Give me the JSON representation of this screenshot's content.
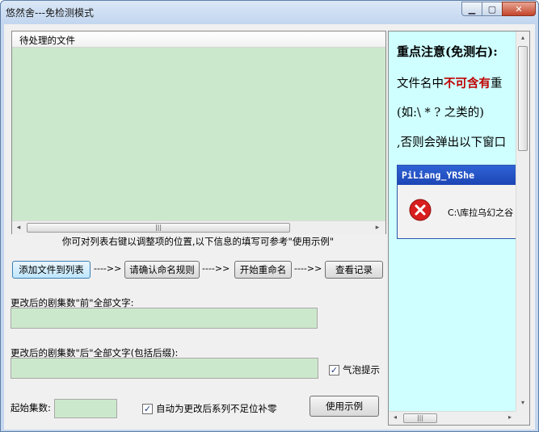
{
  "window": {
    "title": "悠然舍---免检测模式",
    "minimize_glyph": "▁",
    "maximize_glyph": "▢",
    "close_glyph": "✕"
  },
  "file_list": {
    "header": "待处理的文件",
    "scroll_left": "◂",
    "scroll_right": "▸",
    "scroll_thumb_grip": "|||"
  },
  "hint": "你可对列表右键以调整项的位置,以下信息的填写可参考\"使用示例\"",
  "steps": {
    "add_files": "添加文件到列表",
    "confirm_rule": "请确认命名规则",
    "start_rename": "开始重命名",
    "view_log": "查看记录",
    "arrow": "---->>"
  },
  "fields": {
    "before_label": "更改后的剧集数\"前\"全部文字:",
    "before_value": "",
    "after_label": "更改后的剧集数\"后\"全部文字(包括后缀):",
    "after_value": "",
    "start_label": "起始集数:",
    "start_value": ""
  },
  "options": {
    "bubble_tip": "气泡提示",
    "bubble_tip_checked": true,
    "auto_pad": "自动为更改后系列不足位补零",
    "auto_pad_checked": true,
    "check_glyph": "✓"
  },
  "example_button": "使用示例",
  "info_panel": {
    "title": "重点注意(免测右):",
    "line1_prefix": "文件名中",
    "line1_emphasis": "不可含有",
    "line1_suffix": "重",
    "line2": "(如:\\ * ? 之类的)",
    "line3": ",否则会弹出以下窗口",
    "dialog_title": "PiLiang_YRShe",
    "dialog_message": "C:\\库拉乌幻之谷",
    "scroll_up": "▴",
    "scroll_down": "▾",
    "scroll_left": "◂",
    "scroll_right": "▸",
    "scroll_thumb_grip": "|||"
  },
  "colors": {
    "list_bg": "#cce8cc",
    "panel_bg": "#cfffff",
    "emphasis": "#c00000",
    "dialog_title": "#1c45b4",
    "error_icon": "#d81e1e"
  }
}
